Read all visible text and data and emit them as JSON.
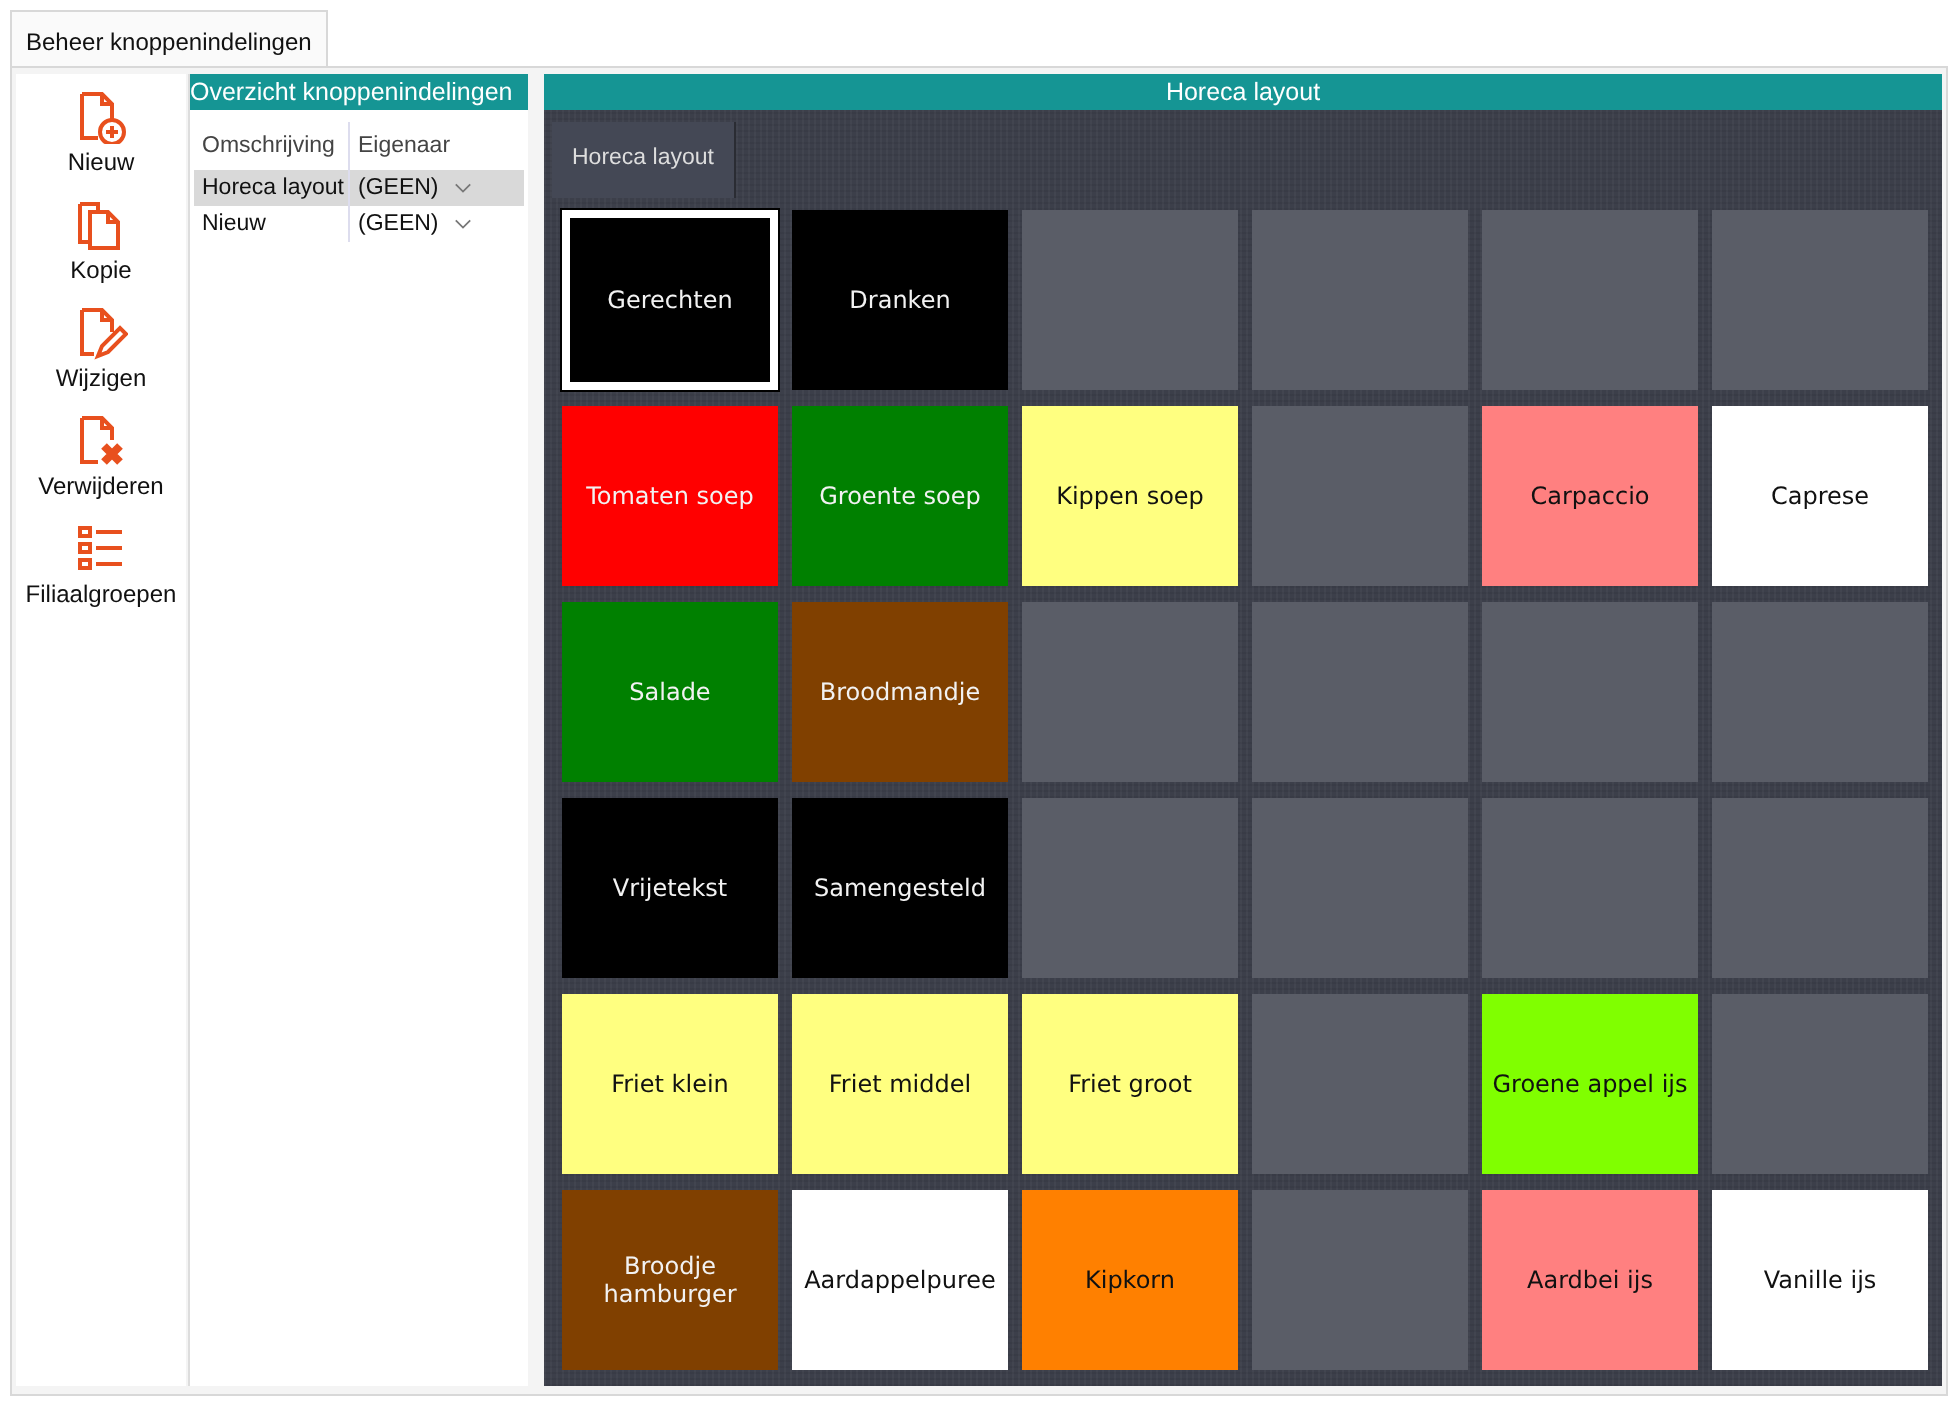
{
  "window_tab": {
    "label": "Beheer knoppenindelingen",
    "selected": true
  },
  "toolbar": [
    {
      "label": "Nieuw",
      "kind": "new"
    },
    {
      "label": "Kopie",
      "kind": "copy"
    },
    {
      "label": "Wijzigen",
      "kind": "edit"
    },
    {
      "label": "Verwijderen",
      "kind": "delete"
    },
    {
      "label": "Filiaalgroepen",
      "kind": "list"
    }
  ],
  "overview": {
    "title": "Overzicht knoppenindelingen",
    "columns": [
      "Omschrijving",
      "Eigenaar"
    ],
    "rows": [
      {
        "description": "Horeca layout",
        "owner": "(GEEN)",
        "selected": true
      },
      {
        "description": "Nieuw",
        "owner": "(GEEN)",
        "selected": false
      }
    ]
  },
  "layout": {
    "title": "Horeca layout",
    "tabs": [
      {
        "label": "Horeca layout",
        "selected": true
      }
    ],
    "tiles": [
      {
        "kind": "button",
        "label": "Gerechten",
        "color": "#000000",
        "selected": true
      },
      {
        "kind": "button",
        "label": "Dranken",
        "color": "#000000",
        "selected": false
      },
      {
        "kind": "empty"
      },
      {
        "kind": "empty"
      },
      {
        "kind": "empty"
      },
      {
        "kind": "empty"
      },
      {
        "kind": "button",
        "label": "Tomaten soep",
        "color": "#ff0000",
        "selected": false
      },
      {
        "kind": "button",
        "label": "Groente soep",
        "color": "#008000",
        "selected": false
      },
      {
        "kind": "button",
        "label": "Kippen soep",
        "color": "#ffff80",
        "selected": false
      },
      {
        "kind": "empty"
      },
      {
        "kind": "button",
        "label": "Carpaccio",
        "color": "#ff8080",
        "selected": false
      },
      {
        "kind": "button",
        "label": "Caprese",
        "color": "#ffffff",
        "selected": false
      },
      {
        "kind": "button",
        "label": "Salade",
        "color": "#008000",
        "selected": false
      },
      {
        "kind": "button",
        "label": "Broodmandje",
        "color": "#804000",
        "selected": false
      },
      {
        "kind": "empty"
      },
      {
        "kind": "empty"
      },
      {
        "kind": "empty"
      },
      {
        "kind": "empty"
      },
      {
        "kind": "button",
        "label": "Vrijetekst",
        "color": "#000000",
        "selected": false
      },
      {
        "kind": "button",
        "label": "Samengesteld",
        "color": "#000000",
        "selected": false
      },
      {
        "kind": "empty"
      },
      {
        "kind": "empty"
      },
      {
        "kind": "empty"
      },
      {
        "kind": "empty"
      },
      {
        "kind": "button",
        "label": "Friet klein",
        "color": "#ffff80",
        "selected": false
      },
      {
        "kind": "button",
        "label": "Friet middel",
        "color": "#ffff80",
        "selected": false
      },
      {
        "kind": "button",
        "label": "Friet groot",
        "color": "#ffff80",
        "selected": false
      },
      {
        "kind": "empty"
      },
      {
        "kind": "button",
        "label": "Groene appel ijs",
        "color": "#80ff00",
        "selected": false
      },
      {
        "kind": "empty"
      },
      {
        "kind": "button",
        "label": "Broodje hamburger",
        "color": "#804000",
        "selected": false
      },
      {
        "kind": "button",
        "label": "Aardappelpuree",
        "color": "#ffffff",
        "selected": false
      },
      {
        "kind": "button",
        "label": "Kipkorn",
        "color": "#ff8000",
        "selected": false
      },
      {
        "kind": "empty"
      },
      {
        "kind": "button",
        "label": "Aardbei ijs",
        "color": "#ff8080",
        "selected": false
      },
      {
        "kind": "button",
        "label": "Vanille ijs",
        "color": "#ffffff",
        "selected": false
      }
    ]
  }
}
